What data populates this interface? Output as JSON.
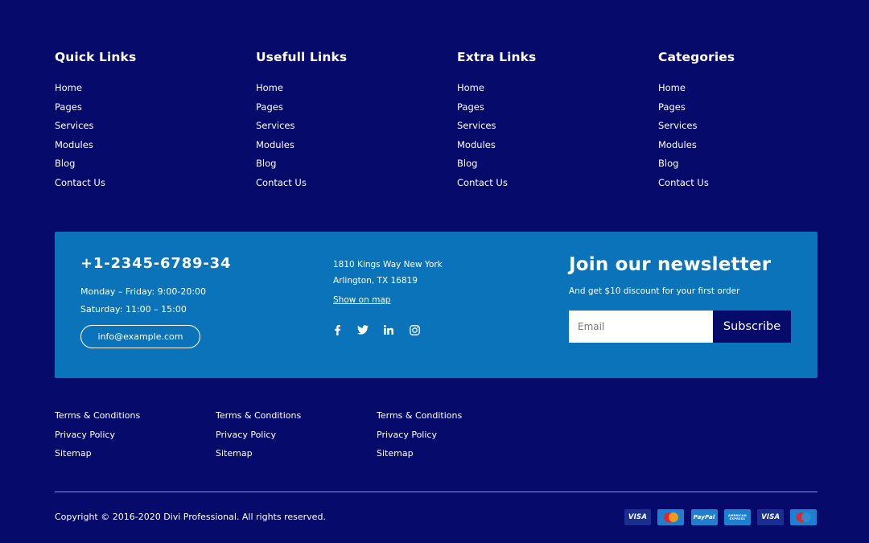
{
  "columns": [
    {
      "title": "Quick Links",
      "links": [
        "Home",
        "Pages",
        "Services",
        "Modules",
        "Blog",
        "Contact Us"
      ]
    },
    {
      "title": "Usefull Links",
      "links": [
        "Home",
        "Pages",
        "Services",
        "Modules",
        "Blog",
        "Contact Us"
      ]
    },
    {
      "title": "Extra Links",
      "links": [
        "Home",
        "Pages",
        "Services",
        "Modules",
        "Blog",
        "Contact Us"
      ]
    },
    {
      "title": "Categories",
      "links": [
        "Home",
        "Pages",
        "Services",
        "Modules",
        "Blog",
        "Contact Us"
      ]
    }
  ],
  "contact": {
    "phone": "+1-2345-6789-34",
    "hours_weekday": "Monday – Friday: 9:00-20:00",
    "hours_saturday": "Saturday: 11:00 – 15:00",
    "email": "info@example.com",
    "address_line1": "1810 Kings Way New York",
    "address_line2": "Arlington, TX 16819",
    "map_link": "Show on map",
    "socials": [
      "facebook-icon",
      "twitter-icon",
      "linkedin-icon",
      "instagram-icon"
    ]
  },
  "newsletter": {
    "title": "Join our newsletter",
    "subtitle": "And get $10 discount for your first order",
    "email_placeholder": "Email",
    "button_label": "Subscribe"
  },
  "legal_columns": [
    [
      "Terms & Conditions",
      "Privacy Policy",
      "Sitemap"
    ],
    [
      "Terms & Conditions",
      "Privacy Policy",
      "Sitemap"
    ],
    [
      "Terms & Conditions",
      "Privacy Policy",
      "Sitemap"
    ]
  ],
  "copyright": "Copyright © 2016-2020 Divi Professional. All rights reserved.",
  "payment_methods": [
    {
      "name": "visa",
      "label": "VISA",
      "color": "#1a2f8f"
    },
    {
      "name": "mastercard",
      "label": "",
      "color": "#1e7fd0"
    },
    {
      "name": "paypal",
      "label": "PayPal",
      "color": "#1e7fd0"
    },
    {
      "name": "american-express",
      "label": "AMERICAN EXPRESS",
      "color": "#1e7fd0"
    },
    {
      "name": "visa",
      "label": "VISA",
      "color": "#1a2f8f"
    },
    {
      "name": "maestro",
      "label": "",
      "color": "#1e7fd0"
    }
  ],
  "colors": {
    "background": "#050a6b",
    "band": "#0a73ba",
    "button": "#050a6b",
    "text": "#ffffff"
  }
}
